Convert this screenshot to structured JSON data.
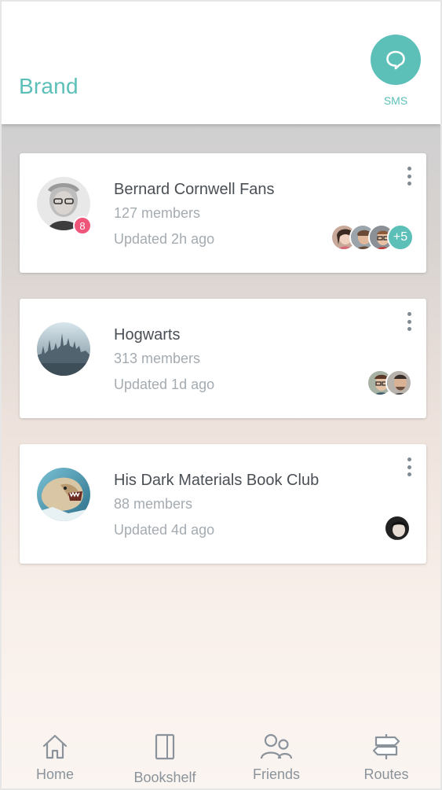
{
  "header": {
    "brand": "Brand",
    "sms_label": "SMS",
    "accent": "#5cc0b8"
  },
  "groups": [
    {
      "name": "Bernard Cornwell Fans",
      "members": "127 members",
      "updated": "Updated 2h ago",
      "unread": "8",
      "more_members": "+5"
    },
    {
      "name": "Hogwarts",
      "members": "313 members",
      "updated": "Updated 1d ago"
    },
    {
      "name": "His Dark Materials Book Club",
      "members": "88 members",
      "updated": "Updated 4d ago"
    }
  ],
  "tabs": [
    {
      "label": "Home",
      "icon": "home-icon"
    },
    {
      "label": "Bookshelf",
      "icon": "book-icon"
    },
    {
      "label": "Friends",
      "icon": "friends-icon"
    },
    {
      "label": "Routes",
      "icon": "signpost-icon"
    }
  ],
  "colors": {
    "badge": "#f0557a",
    "text_primary": "#4a4f55",
    "text_secondary": "#a4abb1"
  }
}
